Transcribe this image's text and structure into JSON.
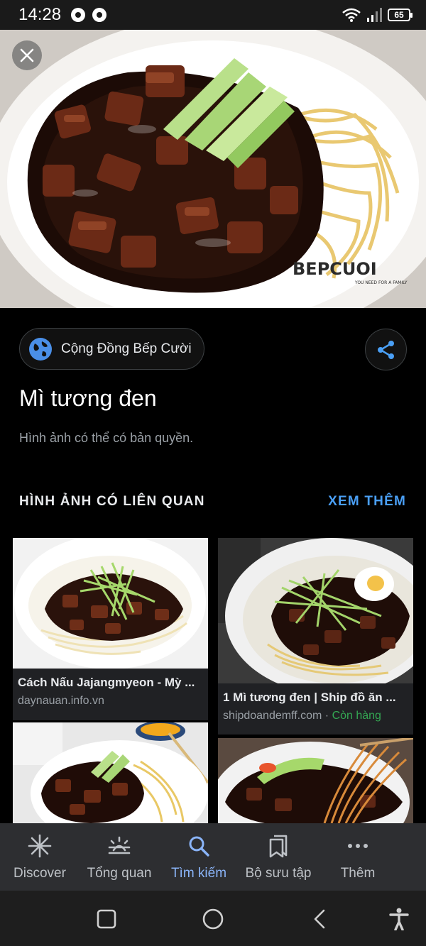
{
  "status_bar": {
    "time": "14:28",
    "battery": "65"
  },
  "source": {
    "name": "Cộng Đồng Bếp Cười"
  },
  "image": {
    "title": "Mì tương đen",
    "copyright_note": "Hình ảnh có thể có bản quyền.",
    "watermark": "BEPCUOI"
  },
  "related": {
    "heading": "HÌNH ẢNH CÓ LIÊN QUAN",
    "see_more": "XEM THÊM",
    "items": [
      {
        "title": "Cách Nấu Jajangmyeon - Mỳ ...",
        "source": "daynauan.info.vn"
      },
      {
        "title": "1 Mì tương đen | Ship đồ ăn ...",
        "source": "shipdoandemff.com",
        "separator": " · ",
        "stock": "Còn hàng"
      },
      {
        "title": "",
        "source": ""
      },
      {
        "title": "",
        "source": ""
      }
    ]
  },
  "bottom_nav": {
    "items": [
      {
        "label": "Discover",
        "icon": "asterisk-icon"
      },
      {
        "label": "Tổng quan",
        "icon": "sunrise-icon"
      },
      {
        "label": "Tìm kiếm",
        "icon": "search-icon",
        "active": true
      },
      {
        "label": "Bộ sưu tập",
        "icon": "bookmarks-icon"
      },
      {
        "label": "Thêm",
        "icon": "more-dots-icon"
      }
    ]
  },
  "colors": {
    "accent": "#4a9ff5",
    "active_nav": "#8ab4f8",
    "in_stock": "#34a853",
    "background": "#000000"
  }
}
